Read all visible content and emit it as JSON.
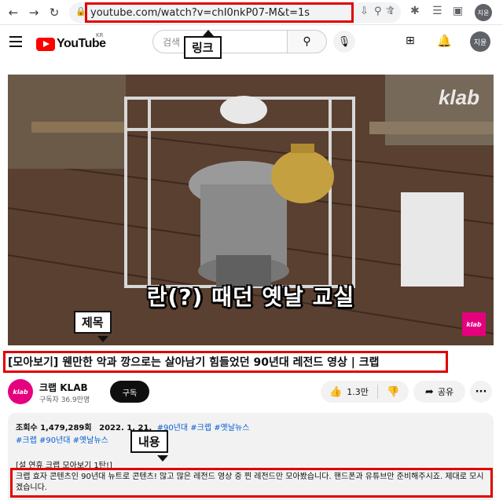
{
  "browser": {
    "url": "youtube.com/watch?v=chI0nkP07-M&t=1s",
    "profile_label": "지윤",
    "icons": [
      "back-arrow",
      "forward-arrow",
      "reload",
      "lock",
      "install",
      "zoom",
      "share",
      "bookmark-star",
      "extensions",
      "reading-list",
      "split-view"
    ]
  },
  "youtube_header": {
    "logo_text": "YouTube",
    "country_code": "KR",
    "search_placeholder": "검색",
    "avatar_label": "지윤"
  },
  "annotations": {
    "link_label": "링크",
    "title_label": "제목",
    "content_label": "내용"
  },
  "video": {
    "subtitle": "란(?) 때던 옛날 교실",
    "watermark": "klab",
    "corner_logo": "klab"
  },
  "video_title": "[모아보기] 웬만한 악과 깡으로는 살아남기 힘들었던 90년대 레전드 영상 | 크랩",
  "channel": {
    "avatar_text": "klab",
    "name": "크랩 KLAB",
    "subscribers": "구독자 36.9만명",
    "subscribe_label": "구독"
  },
  "actions": {
    "like_count": "1.3만",
    "share_label": "공유",
    "more_label": "···"
  },
  "description": {
    "views": "조회수 1,479,289회",
    "date": "2022. 1. 21.",
    "hashtags_line1": [
      "#90년대",
      "#크랩",
      "#옛날뉴스"
    ],
    "hashtags_line2": [
      "#크랩",
      "#90년대",
      "#옛날뉴스"
    ],
    "heading": "[설 연휴 크랩 모아보기 1탄!]",
    "body": "크랩 효자 콘텐츠인 90년대 뉴트로 콘텐츠! 많고 많은 레전드 영상 중 찐 레전드만 모아봤습니다. 핸드폰과 유튜브만 준비해주시죠. 제대로 모시겠습니다."
  }
}
